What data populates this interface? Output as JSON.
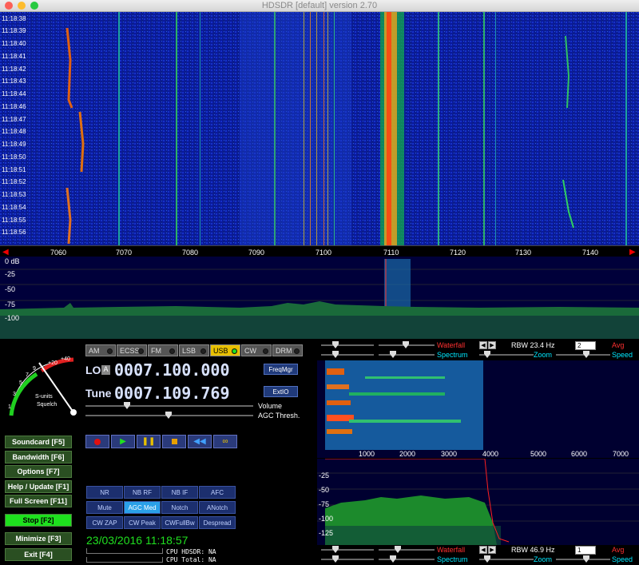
{
  "window": {
    "title": "HDSDR [default]  version 2.70"
  },
  "waterfall": {
    "timestamps": [
      "11:18:38",
      "11:18:39",
      "11:18:40",
      "11:18:41",
      "11:18:42",
      "11:18:43",
      "11:18:44",
      "11:18:46",
      "11:18:47",
      "11:18:48",
      "11:18:49",
      "11:18:50",
      "11:18:51",
      "11:18:52",
      "11:18:53",
      "11:18:54",
      "11:18:55",
      "11:18:56"
    ],
    "freq_ticks": [
      "7060",
      "7070",
      "7080",
      "7090",
      "7100",
      "7110",
      "7120",
      "7130",
      "7140"
    ]
  },
  "spectrum": {
    "db_labels": [
      "0 dB",
      "-25",
      "-50",
      "-75",
      "-100"
    ]
  },
  "sidebar": {
    "buttons": [
      {
        "label": "Soundcard  [F5]"
      },
      {
        "label": "Bandwidth  [F6]"
      },
      {
        "label": "Options    [F7]"
      },
      {
        "label": "Help / Update  [F1]"
      },
      {
        "label": "Full Screen  [F11]"
      },
      {
        "label": "Stop       [F2]"
      },
      {
        "label": "Minimize  [F3]"
      },
      {
        "label": "Exit       [F4]"
      }
    ]
  },
  "smeter": {
    "scale": [
      "1",
      "3",
      "5",
      "7",
      "9",
      "+20",
      "+40"
    ],
    "label1": "S-units",
    "label2": "Squelch"
  },
  "modes": [
    "AM",
    "ECSS",
    "FM",
    "LSB",
    "USB",
    "CW",
    "DRM"
  ],
  "active_mode": "USB",
  "lo": {
    "label": "LO",
    "badge": "A",
    "value": "0007.100.000"
  },
  "tune": {
    "label": "Tune",
    "value": "0007.109.769"
  },
  "buttons": {
    "freqmgr": "FreqMgr",
    "extio": "ExtIO"
  },
  "sliders": {
    "volume": "Volume",
    "agc": "AGC Thresh."
  },
  "dsp": [
    "NR",
    "NB RF",
    "NB IF",
    "AFC",
    "Mute",
    "AGC Med",
    "Notch",
    "ANotch",
    "CW ZAP",
    "CW Peak",
    "CWFullBw",
    "Despread"
  ],
  "datetime": "23/03/2016  11:18:57",
  "cpu": {
    "hdsdr": "CPU HDSDR: NA",
    "total": "CPU Total: NA"
  },
  "right_top": {
    "waterfall": "Waterfall",
    "spectrum": "Spectrum",
    "rbw": "RBW 23.4 Hz",
    "avg_value": "2",
    "avg": "Avg",
    "zoom": "Zoom",
    "speed": "Speed"
  },
  "zoom_scale": [
    "1000",
    "2000",
    "3000",
    "4000",
    "5000",
    "6000",
    "7000"
  ],
  "zoom_db": [
    "-25",
    "-50",
    "-75",
    "-100",
    "-125"
  ],
  "right_bottom": {
    "waterfall": "Waterfall",
    "spectrum": "Spectrum",
    "rbw": "RBW 46.9 Hz",
    "avg_value": "1",
    "avg": "Avg",
    "zoom": "Zoom",
    "speed": "Speed"
  },
  "colors": {
    "waterfall_bg": "#07107a",
    "active_green": "#1ee01e",
    "usb_yellow": "#e8c000",
    "agc_blue": "#2aa0e8"
  }
}
